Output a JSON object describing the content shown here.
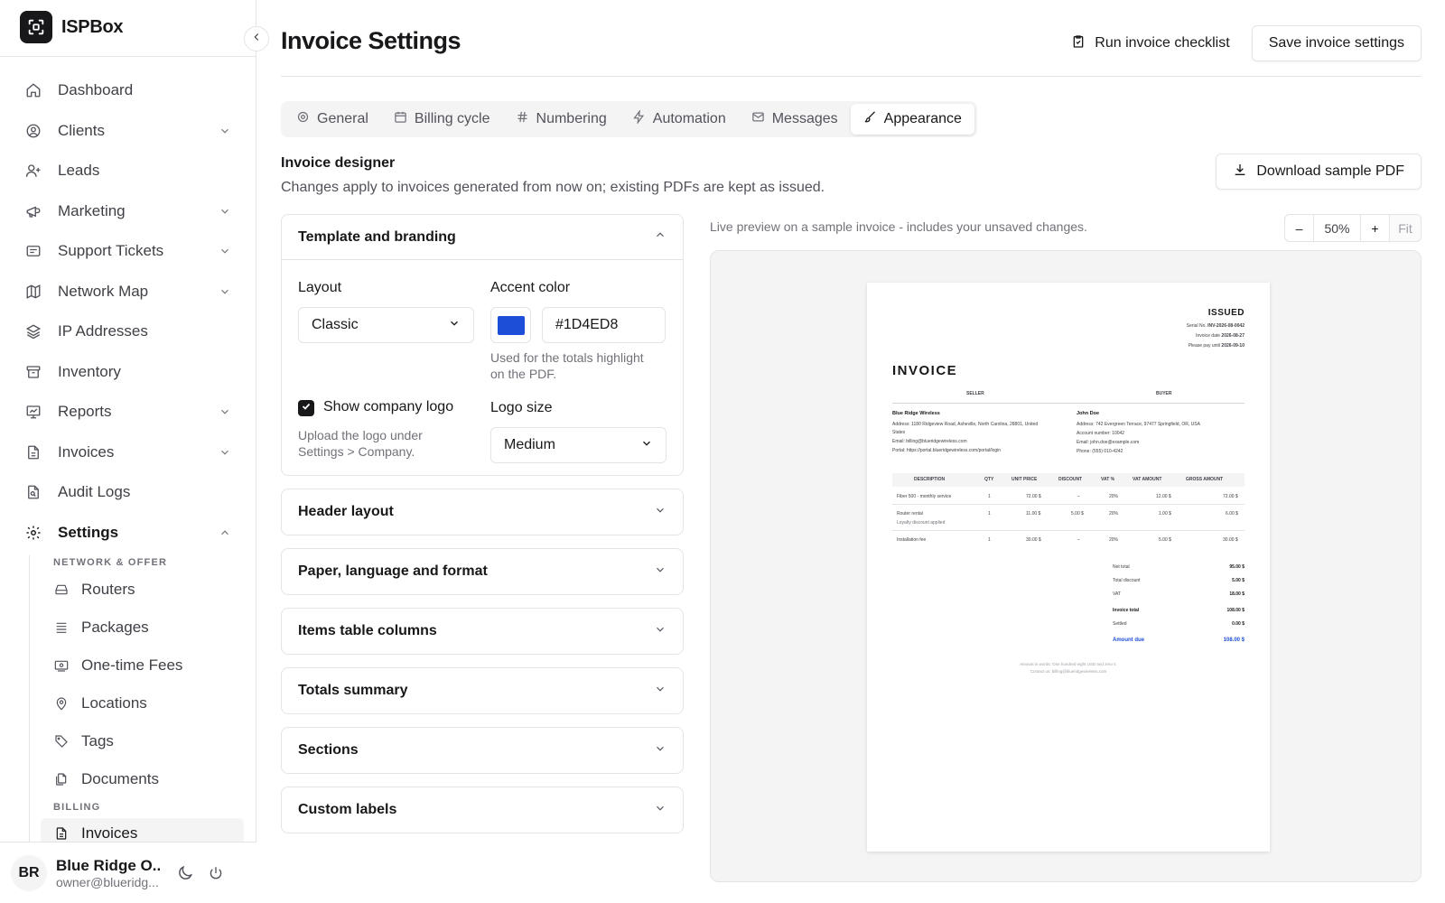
{
  "brand": {
    "name": "ISPBox"
  },
  "nav": {
    "items": [
      {
        "label": "Dashboard",
        "icon": "home-icon"
      },
      {
        "label": "Clients",
        "icon": "user-circle-icon"
      },
      {
        "label": "Leads",
        "icon": "user-plus-icon"
      },
      {
        "label": "Marketing",
        "icon": "megaphone-icon"
      },
      {
        "label": "Support Tickets",
        "icon": "ticket-icon"
      },
      {
        "label": "Network Map",
        "icon": "map-icon"
      },
      {
        "label": "IP Addresses",
        "icon": "layers-icon"
      },
      {
        "label": "Inventory",
        "icon": "archive-icon"
      },
      {
        "label": "Reports",
        "icon": "chart-icon"
      },
      {
        "label": "Invoices",
        "icon": "file-icon"
      },
      {
        "label": "Audit Logs",
        "icon": "file-search-icon"
      },
      {
        "label": "Settings",
        "icon": "gear-icon"
      }
    ],
    "section_network": "NETWORK & OFFER",
    "sub_items": [
      {
        "label": "Routers",
        "icon": "router-icon"
      },
      {
        "label": "Packages",
        "icon": "list-icon"
      },
      {
        "label": "One-time Fees",
        "icon": "banknote-icon"
      },
      {
        "label": "Locations",
        "icon": "map-pin-icon"
      },
      {
        "label": "Tags",
        "icon": "tag-icon"
      },
      {
        "label": "Documents",
        "icon": "files-icon"
      }
    ],
    "section_billing": "BILLING",
    "billing_items": [
      {
        "label": "Invoices",
        "icon": "file-icon"
      }
    ]
  },
  "user": {
    "initials": "BR",
    "name": "Blue Ridge O...",
    "email": "owner@blueridg..."
  },
  "page": {
    "title": "Invoice Settings",
    "checklist_label": "Run invoice checklist",
    "save_label": "Save invoice settings"
  },
  "tabs": [
    "General",
    "Billing cycle",
    "Numbering",
    "Automation",
    "Messages",
    "Appearance"
  ],
  "designer": {
    "title": "Invoice designer",
    "description": "Changes apply to invoices generated from now on; existing PDFs are kept as issued.",
    "download_label": "Download sample PDF",
    "preview_note": "Live preview on a sample invoice - includes your unsaved changes.",
    "zoom": "50%",
    "zoom_minus": "–",
    "zoom_plus": "+",
    "zoom_fit": "Fit"
  },
  "template": {
    "title": "Template and branding",
    "layout_label": "Layout",
    "layout_value": "Classic",
    "accent_label": "Accent color",
    "accent_value": "#1D4ED8",
    "accent_help_1": "Used for the totals highlight",
    "accent_help_2": "on the PDF.",
    "logo_checkbox_label": "Show company logo",
    "logo_help_1": "Upload the logo under",
    "logo_help_2": "Settings > Company.",
    "logo_size_label": "Logo size",
    "logo_size_value": "Medium"
  },
  "accordions": [
    "Header layout",
    "Paper, language and format",
    "Items table columns",
    "Totals summary",
    "Sections",
    "Custom labels"
  ],
  "invoice": {
    "status": "ISSUED",
    "serial_label": "Serial No.",
    "serial": "INV-2026-08-0042",
    "date_label": "Invoice date",
    "date": "2026-08-27",
    "due_label": "Please pay until",
    "due": "2026-09-10",
    "heading": "INVOICE",
    "seller_label": "SELLER",
    "buyer_label": "BUYER",
    "seller": {
      "name": "Blue Ridge Wireless",
      "address_1": "Address: 1180 Ridgeview Road, Asheville, North Carolina, 28801, United",
      "address_2": "States",
      "email": "Email: billing@blueridgewireless.com",
      "portal": "Portal: https://portal.blueridgewireless.com/portal/login"
    },
    "buyer": {
      "name": "John Doe",
      "address": "Address: 742 Evergreen Terrace, 97477 Springfield, OR, USA",
      "account": "Account number: 10042",
      "email": "Email: john.doe@example.com",
      "phone": "Phone: (555) 010-4242"
    },
    "columns": [
      "DESCRIPTION",
      "QTY",
      "UNIT PRICE",
      "DISCOUNT",
      "VAT %",
      "VAT AMOUNT",
      "GROSS AMOUNT"
    ],
    "rows": [
      {
        "desc": "Fiber 500 - monthly service",
        "note": "",
        "qty": "1",
        "unit": "72.00 $",
        "disc": "–",
        "vat": "20%",
        "vat_amt": "12.00 $",
        "gross": "72.00 $"
      },
      {
        "desc": "Router rental",
        "note": "Loyalty discount applied",
        "qty": "1",
        "unit": "11.00 $",
        "disc": "5.00 $",
        "vat": "20%",
        "vat_amt": "1.00 $",
        "gross": "6.00 $"
      },
      {
        "desc": "Installation fee",
        "note": "",
        "qty": "1",
        "unit": "30.00 $",
        "disc": "–",
        "vat": "20%",
        "vat_amt": "5.00 $",
        "gross": "30.00 $"
      }
    ],
    "totals": [
      {
        "label": "Net total",
        "value": "95.00 $"
      },
      {
        "label": "Total discount",
        "value": "5.00 $"
      },
      {
        "label": "VAT",
        "value": "18.00 $"
      },
      {
        "label": "Invoice total",
        "value": "108.00 $"
      },
      {
        "label": "Settled",
        "value": "0.00 $"
      },
      {
        "label": "Amount due",
        "value": "108.00 $"
      }
    ],
    "footer_1": "Amount in words: One hundred eight USD and zero ¢.",
    "footer_2": "Contact us: billing@blueridgewireless.com"
  },
  "colors": {
    "accent": "#1D4ED8",
    "border": "#E4E4E7",
    "muted": "#71717A"
  }
}
